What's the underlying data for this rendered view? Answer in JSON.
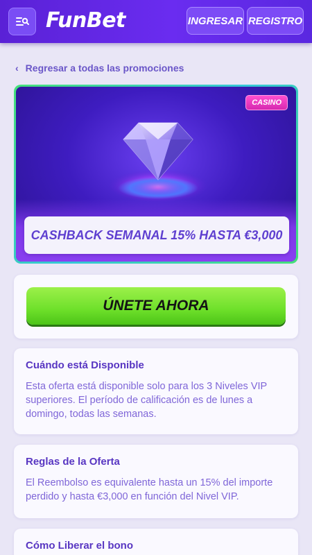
{
  "header": {
    "logo_text": "FunBet",
    "login_label": "INGRESAR",
    "register_label": "REGISTRO",
    "menu_icon": "menu-search-icon"
  },
  "back_link": {
    "label": "Regresar a todas las promociones"
  },
  "promo": {
    "badge": "CASINO",
    "title": "CASHBACK SEMANAL 15% HASTA €3,000",
    "image": "diamond-icon"
  },
  "cta": {
    "label": "ÚNETE AHORA"
  },
  "sections": [
    {
      "heading": "Cuándo está Disponible",
      "body": "Esta oferta está disponible solo para los 3 Niveles VIP superiores. El período de calificación es de lunes a domingo, todas las semanas."
    },
    {
      "heading": "Reglas de la Oferta",
      "body": "El Reembolso es equivalente hasta un 15% del importe perdido y hasta €3,000 en función del Nivel VIP."
    },
    {
      "heading": "Cómo Liberar el bono"
    }
  ],
  "colors": {
    "header_bg": "#6a2cf0",
    "accent_text": "#5e3fd0",
    "cta_green": "#6ee02a",
    "badge_pink": "#e02cb8"
  }
}
